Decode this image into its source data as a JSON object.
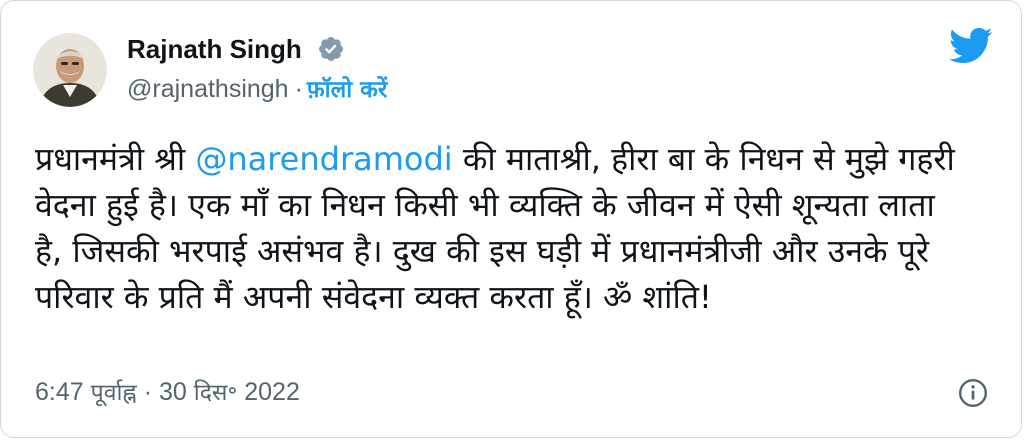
{
  "author": {
    "name": "Rajnath Singh",
    "handle": "@rajnathsingh",
    "separator": "·",
    "follow_label": "फ़ॉलो करें"
  },
  "tweet": {
    "text_before_mention": "प्रधानमंत्री श्री ",
    "mention": "@narendramodi",
    "text_after_mention": " की माताश्री, हीरा बा के निधन से मुझे गहरी वेदना हुई है। एक माँ का निधन किसी भी व्यक्ति के जीवन में ऐसी शून्यता लाता है, जिसकी भरपाई असंभव है। दुख की इस घड़ी में प्रधानमंत्रीजी और उनके पूरे परिवार के प्रति मैं अपनी संवेदना व्यक्त करता हूँ। ॐ शांति!"
  },
  "timestamp": {
    "time": "6:47",
    "period": "पूर्वाह्न",
    "separator": "·",
    "date_day": "30",
    "date_month": "दिस॰",
    "date_year": "2022"
  },
  "icons": {
    "verified": "verified-badge-icon",
    "brand": "twitter-bird-icon",
    "info": "info-icon"
  },
  "colors": {
    "accent": "#1d9bf0",
    "text": "#0f1419",
    "muted": "#536471",
    "border": "#cfd9de"
  }
}
